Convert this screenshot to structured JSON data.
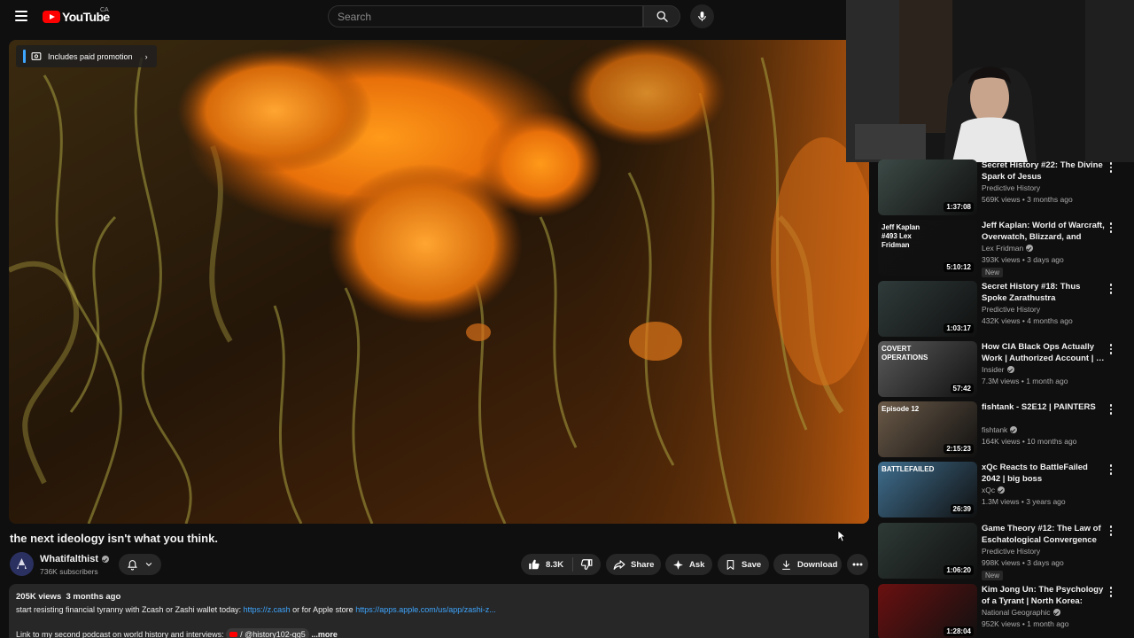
{
  "header": {
    "logo_text": "YouTube",
    "region": "CA",
    "search_placeholder": "Search"
  },
  "player": {
    "promo_label": "Includes paid promotion"
  },
  "video": {
    "title": "the next ideology isn't what you think.",
    "channel_name": "Whatifalthist",
    "subscribers": "736K subscribers",
    "likes": "8.3K",
    "share_label": "Share",
    "ask_label": "Ask",
    "save_label": "Save",
    "download_label": "Download"
  },
  "description": {
    "views_date": "205K views  3 months ago",
    "line1_text": "start resisting financial tyranny with Zcash or Zashi wallet today: ",
    "line1_link1": "https://z.cash",
    "line1_mid": " or for Apple store ",
    "line1_link2": "https://apps.apple.com/us/app/zashi-z...",
    "line2_text": "Link to my second podcast on world history and interviews: ",
    "line2_chip": "/ @history102-qg5",
    "more": "...more"
  },
  "recommendations": [
    {
      "title": "Secret History #22: The Divine Spark of Jesus",
      "channel": "Predictive History",
      "verified": false,
      "meta": "569K views • 3 months ago",
      "duration": "1:37:08",
      "badge": "",
      "thumb_bg": "#3c4a46",
      "thumb_text": ""
    },
    {
      "title": "Jeff Kaplan: World of Warcraft, Overwatch, Blizzard, and Futur…",
      "channel": "Lex Fridman",
      "verified": true,
      "meta": "393K views • 3 days ago",
      "duration": "5:10:12",
      "badge": "New",
      "thumb_bg": "#111111",
      "thumb_text": "Jeff Kaplan #493 Lex Fridman"
    },
    {
      "title": "Secret History #18:  Thus Spoke Zarathustra",
      "channel": "Predictive History",
      "verified": false,
      "meta": "432K views • 4 months ago",
      "duration": "1:03:17",
      "badge": "",
      "thumb_bg": "#2f3b3a",
      "thumb_text": ""
    },
    {
      "title": "How CIA Black Ops Actually Work | Authorized Account | …",
      "channel": "Insider",
      "verified": true,
      "meta": "7.3M views • 1 month ago",
      "duration": "57:42",
      "badge": "",
      "thumb_bg": "#5a5a5a",
      "thumb_text": "COVERT OPERATIONS"
    },
    {
      "title": "fishtank - S2E12 | PAINTERS",
      "channel": "fishtank",
      "verified": true,
      "meta": "164K views • 10 months ago",
      "duration": "2:15:23",
      "badge": "",
      "thumb_bg": "#6b5a48",
      "thumb_text": "Episode 12"
    },
    {
      "title": "xQc Reacts to BattleFailed 2042 | big boss",
      "channel": "xQc",
      "verified": true,
      "meta": "1.3M views • 3 years ago",
      "duration": "26:39",
      "badge": "",
      "thumb_bg": "#3f6e8e",
      "thumb_text": "BATTLEFAILED"
    },
    {
      "title": "Game Theory #12:  The Law of Eschatological Convergence",
      "channel": "Predictive History",
      "verified": false,
      "meta": "998K views • 3 days ago",
      "duration": "1:06:20",
      "badge": "New",
      "thumb_bg": "#2e3a36",
      "thumb_text": ""
    },
    {
      "title": "Kim Jong Un: The Psychology of a Tyrant | North Korea: Insid…",
      "channel": "National Geographic",
      "verified": true,
      "meta": "952K views • 1 month ago",
      "duration": "1:28:04",
      "badge": "",
      "thumb_bg": "#6a1010",
      "thumb_text": ""
    }
  ],
  "colors": {
    "background": "#0f0f0f",
    "surface": "#272727",
    "link": "#3ea6ff",
    "brand_red": "#ff0000",
    "secondary_text": "#aaaaaa"
  }
}
